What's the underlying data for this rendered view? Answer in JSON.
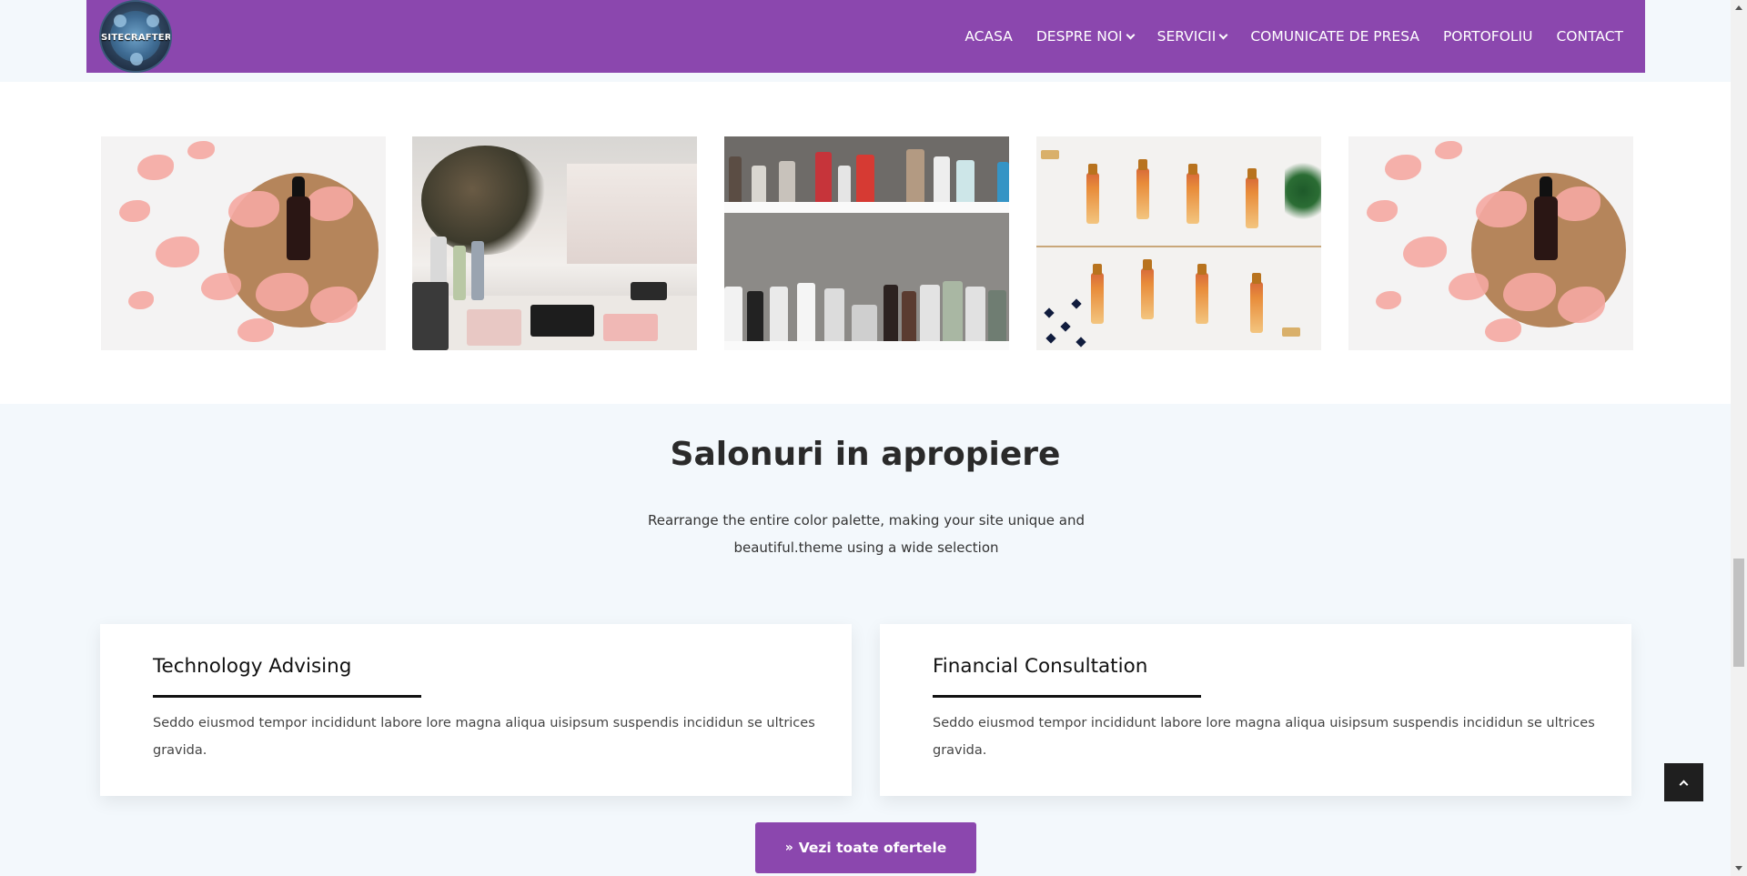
{
  "header": {
    "logo_text": "SITECRAFTER",
    "nav": [
      {
        "label": "ACASA",
        "has_dropdown": false
      },
      {
        "label": "DESPRE NOI",
        "has_dropdown": true
      },
      {
        "label": "SERVICII",
        "has_dropdown": true
      },
      {
        "label": "COMUNICATE DE PRESA",
        "has_dropdown": false
      },
      {
        "label": "PORTOFOLIU",
        "has_dropdown": false
      },
      {
        "label": "CONTACT",
        "has_dropdown": false
      }
    ]
  },
  "gallery": {
    "images": [
      "rose-petals-oil-bottle",
      "cosmetics-shop-display",
      "product-shelf",
      "essential-oil-vials",
      "rose-petals-oil-bottle"
    ]
  },
  "salons": {
    "title": "Salonuri in apropiere",
    "subtitle": "Rearrange the entire color palette, making your site unique and beautiful.theme using a wide selection",
    "cards": [
      {
        "title": "Technology Advising",
        "text": "Seddo eiusmod tempor incididunt labore lore magna aliqua uisipsum suspendis incididun se ultrices gravida."
      },
      {
        "title": "Financial Consultation",
        "text": "Seddo eiusmod tempor incididunt labore lore magna aliqua uisipsum suspendis incididun se ultrices gravida."
      }
    ],
    "cta_label": "Vezi toate ofertele",
    "cta_icon": "double-chevron-right-icon"
  },
  "colors": {
    "brand": "#8b47ae",
    "page_bg": "#f3f8fc",
    "to_top_bg": "#1f1f1f"
  }
}
